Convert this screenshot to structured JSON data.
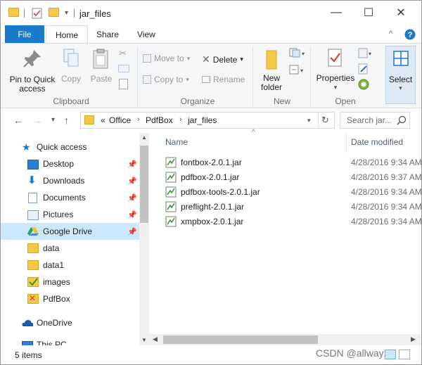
{
  "window": {
    "title": "jar_files",
    "minimize": "—",
    "maximize": "☐",
    "close": "✕"
  },
  "ribbon_tabs": [
    "File",
    "Home",
    "Share",
    "View"
  ],
  "ribbon": {
    "clipboard": {
      "pin": "Pin to Quick access",
      "copy": "Copy",
      "paste": "Paste",
      "label": "Clipboard"
    },
    "organize": {
      "move_to": "Move to",
      "copy_to": "Copy to",
      "delete": "Delete",
      "rename": "Rename",
      "label": "Organize"
    },
    "new": {
      "new_folder": "New folder",
      "label": "New"
    },
    "open": {
      "properties": "Properties",
      "label": "Open"
    },
    "select": {
      "select": "Select"
    }
  },
  "address": {
    "overflow": "«",
    "path": [
      "Office",
      "PdfBox",
      "jar_files"
    ]
  },
  "search": {
    "placeholder": "Search jar..."
  },
  "nav_pane": {
    "quick_access": "Quick access",
    "items": [
      {
        "label": "Desktop",
        "icon": "desktop-icon",
        "pinned": true
      },
      {
        "label": "Downloads",
        "icon": "download-icon",
        "pinned": true
      },
      {
        "label": "Documents",
        "icon": "documents-icon",
        "pinned": true
      },
      {
        "label": "Pictures",
        "icon": "pictures-icon",
        "pinned": true
      },
      {
        "label": "Google Drive",
        "icon": "google-drive-icon",
        "pinned": true
      },
      {
        "label": "data",
        "icon": "folder-icon",
        "pinned": false
      },
      {
        "label": "data1",
        "icon": "folder-icon",
        "pinned": false
      },
      {
        "label": "images",
        "icon": "folder-icon",
        "pinned": false
      },
      {
        "label": "PdfBox",
        "icon": "folder-icon",
        "pinned": false
      }
    ],
    "onedrive": "OneDrive",
    "this_pc": "This PC"
  },
  "content": {
    "col_name": "Name",
    "col_date": "Date modified",
    "files": [
      {
        "name": "fontbox-2.0.1.jar",
        "date": "4/28/2016 9:34 AM"
      },
      {
        "name": "pdfbox-2.0.1.jar",
        "date": "4/28/2016 9:37 AM"
      },
      {
        "name": "pdfbox-tools-2.0.1.jar",
        "date": "4/28/2016 9:34 AM"
      },
      {
        "name": "preflight-2.0.1.jar",
        "date": "4/28/2016 9:34 AM"
      },
      {
        "name": "xmpbox-2.0.1.jar",
        "date": "4/28/2016 9:34 AM"
      }
    ]
  },
  "status": {
    "items": "5 items",
    "watermark": "CSDN @allway2"
  },
  "colors": {
    "file_tab": "#1979ca",
    "selected_nav": "#cce8ff",
    "folder": "#f5c948"
  }
}
